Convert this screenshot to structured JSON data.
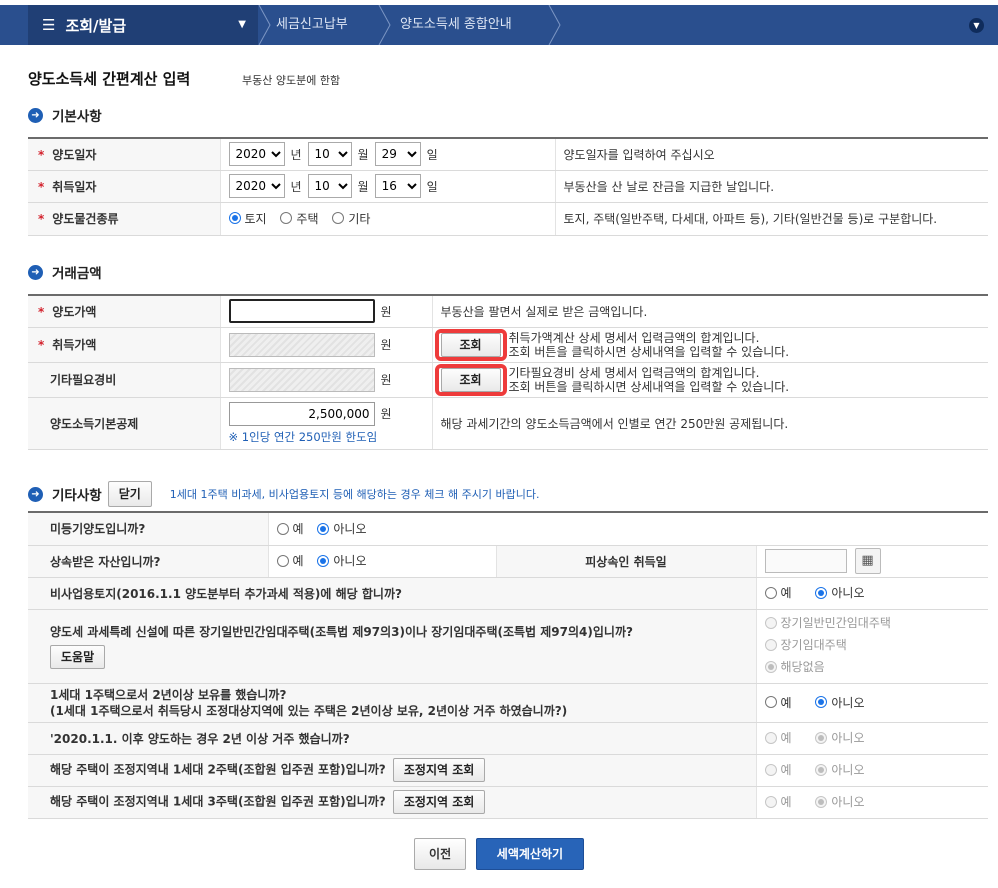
{
  "nav": {
    "menu_label": "조회/발급",
    "crumb1": "세금신고납부",
    "crumb2": "양도소득세 종합안내"
  },
  "page": {
    "title": "양도소득세 간편계산 입력",
    "subtitle": "부동산 양도분에 한함"
  },
  "basic": {
    "heading": "기본사항",
    "transfer_date": {
      "label": "양도일자",
      "year": "2020",
      "month": "10",
      "day": "29",
      "desc": "양도일자를 입력하여 주십시오"
    },
    "acquire_date": {
      "label": "취득일자",
      "year": "2020",
      "month": "10",
      "day": "16",
      "desc": "부동산을 산 날로 잔금을 지급한 날입니다."
    },
    "year_unit": "년",
    "month_unit": "월",
    "day_unit": "일",
    "property_type": {
      "label": "양도물건종류",
      "options": [
        "토지",
        "주택",
        "기타"
      ],
      "selected": "토지",
      "desc": "토지, 주택(일반주택, 다세대, 아파트 등), 기타(일반건물 등)로 구분합니다."
    }
  },
  "amount": {
    "heading": "거래금액",
    "won": "원",
    "transfer_price": {
      "label": "양도가액",
      "value": "",
      "desc": "부동산을 팔면서 실제로 받은 금액입니다."
    },
    "acquire_price": {
      "label": "취득가액",
      "button": "조회",
      "desc1": "취득가액계산 상세 명세서 입력금액의 합계입니다.",
      "desc2": "조회 버튼을 클릭하시면 상세내역을 입력할 수 있습니다."
    },
    "other_expense": {
      "label": "기타필요경비",
      "button": "조회",
      "desc1": "기타필요경비 상세 명세서 입력금액의 합계입니다.",
      "desc2": "조회 버튼을 클릭하시면 상세내역을 입력할 수 있습니다."
    },
    "basic_deduction": {
      "label": "양도소득기본공제",
      "value": "2,500,000",
      "note": "※ 1인당 연간 250만원 한도임",
      "desc": "해당 과세기간의 양도소득금액에서 인별로 연간 250만원 공제됩니다."
    }
  },
  "other": {
    "heading": "기타사항",
    "close_button": "닫기",
    "notice": "1세대 1주택 비과세, 비사업용토지 등에 해당하는 경우 체크 해 주시기 바랍니다.",
    "yes": "예",
    "no": "아니오",
    "q1": "미등기양도입니까?",
    "q2": "상속받은 자산입니까?",
    "q2_date_label": "피상속인 취득일",
    "q3": "비사업용토지(2016.1.1 양도분부터 추가과세 적용)에 해당 합니까?",
    "q4": "양도세 과세특례 신설에 따른 장기일반민간임대주택(조특법 제97의3)이나 장기임대주택(조특법 제97의4)입니까?",
    "q4_help": "도움말",
    "q4_options": [
      "장기일반민간임대주택",
      "장기임대주택",
      "해당없음"
    ],
    "q5_line1": "1세대 1주택으로서 2년이상 보유를 했습니까?",
    "q5_line2": "(1세대 1주택으로서 취득당시 조정대상지역에 있는 주택은 2년이상 보유, 2년이상 거주 하였습니까?)",
    "q6": "'2020.1.1. 이후 양도하는 경우 2년 이상 거주 했습니까?",
    "q7": "해당 주택이 조정지역내 1세대 2주택(조합원 입주권 포함)입니까?",
    "q8": "해당 주택이 조정지역내 1세대 3주택(조합원 입주권 포함)입니까?",
    "region_button": "조정지역 조회"
  },
  "footer": {
    "prev": "이전",
    "calc": "세액계산하기"
  },
  "colors": {
    "nav_bg": "#2a4f8e",
    "accent_blue": "#1f5fb5",
    "required_red": "#d3232e",
    "highlight_red": "#ee3b3b"
  }
}
